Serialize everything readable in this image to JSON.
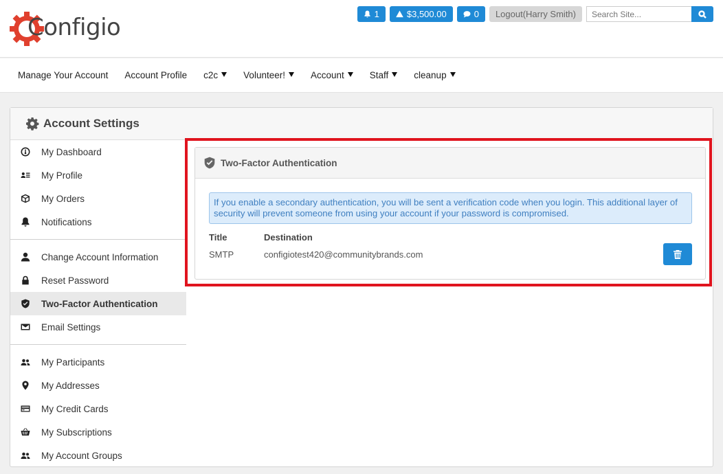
{
  "header": {
    "logo_text": "Configio",
    "alerts_count": "1",
    "balance": "$3,500.00",
    "messages_count": "0",
    "logout_label": "Logout(Harry Smith)",
    "search_placeholder": "Search Site..."
  },
  "nav": {
    "items": [
      {
        "label": "Manage Your Account",
        "dropdown": false
      },
      {
        "label": "Account Profile",
        "dropdown": false
      },
      {
        "label": "c2c",
        "dropdown": true
      },
      {
        "label": "Volunteer!",
        "dropdown": true
      },
      {
        "label": "Account",
        "dropdown": true
      },
      {
        "label": "Staff",
        "dropdown": true
      },
      {
        "label": "cleanup",
        "dropdown": true
      }
    ]
  },
  "panel": {
    "title": "Account Settings"
  },
  "sidebar": {
    "items": [
      {
        "label": "My Dashboard",
        "icon": "dashboard-icon"
      },
      {
        "label": "My Profile",
        "icon": "profile-card-icon"
      },
      {
        "label": "My Orders",
        "icon": "box-icon"
      },
      {
        "label": "Notifications",
        "icon": "bell-icon"
      },
      {
        "label": "Change Account Information",
        "icon": "user-icon"
      },
      {
        "label": "Reset Password",
        "icon": "lock-icon"
      },
      {
        "label": "Two-Factor Authentication",
        "icon": "shield-icon",
        "active": true
      },
      {
        "label": "Email Settings",
        "icon": "envelope-icon"
      },
      {
        "label": "My Participants",
        "icon": "users-icon"
      },
      {
        "label": "My Addresses",
        "icon": "map-pin-icon"
      },
      {
        "label": "My Credit Cards",
        "icon": "credit-card-icon"
      },
      {
        "label": "My Subscriptions",
        "icon": "basket-icon"
      },
      {
        "label": "My Account Groups",
        "icon": "group-icon"
      }
    ]
  },
  "twofa": {
    "title": "Two-Factor Authentication",
    "info": "If you enable a secondary authentication, you will be sent a verification code when you login. This additional layer of security will prevent someone from using your account if your password is compromised.",
    "columns": [
      "Title",
      "Destination"
    ],
    "rows": [
      {
        "title": "SMTP",
        "destination": "configiotest420@communitybrands.com"
      }
    ]
  },
  "colors": {
    "primary": "#1f8ad6",
    "highlight": "#e0141e",
    "logo_gear": "#e0402e",
    "info_bg": "#dcecfb"
  }
}
